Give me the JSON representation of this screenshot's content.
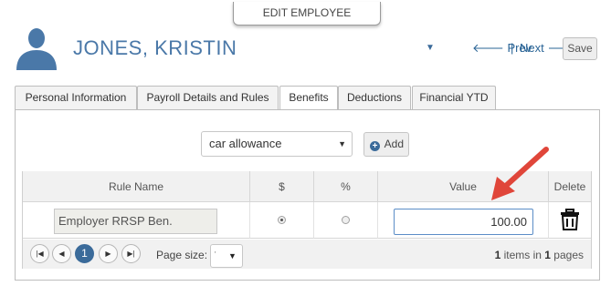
{
  "header": {
    "tab_title": "EDIT EMPLOYEE",
    "employee_name": "JONES, KRISTIN",
    "prev_label": "Prev",
    "separator": "|",
    "next_label": "Next",
    "save_label": "Save"
  },
  "tabs": [
    {
      "label": "Personal Information",
      "active": false
    },
    {
      "label": "Payroll Details and Rules",
      "active": false
    },
    {
      "label": "Benefits",
      "active": true
    },
    {
      "label": "Deductions",
      "active": false
    },
    {
      "label": "Financial YTD",
      "active": false
    }
  ],
  "benefits": {
    "rule_select_value": "car allowance",
    "add_label": "Add",
    "columns": [
      "Rule Name",
      "$",
      "%",
      "Value",
      "Delete"
    ],
    "rows": [
      {
        "rule_name": "Employer RRSP Ben.",
        "type": "$",
        "value": "100.00"
      }
    ]
  },
  "pager": {
    "current_page": "1",
    "page_size_label": "Page size:",
    "items_count": "1",
    "items_text": " items in ",
    "pages_count": "1",
    "pages_text": " pages"
  },
  "colors": {
    "accent": "#3b6b9a",
    "name_color": "#4a78a8",
    "annotation_arrow": "#e0463a"
  }
}
